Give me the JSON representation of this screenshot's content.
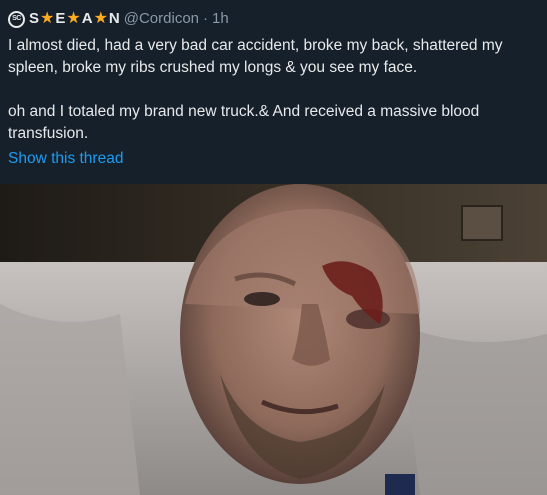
{
  "tweet": {
    "account_logo_text": "SC",
    "name_parts": [
      "S",
      "E",
      "A",
      "N"
    ],
    "handle": "@Cordicon",
    "separator": "·",
    "time": "1h",
    "paragraph_1": "I almost died, had a very bad car accident, broke my back, shattered my spleen, broke my ribs crushed my longs & you see my face.",
    "paragraph_2": "oh and I totaled my brand new truck.& And received a massive blood transfusion.",
    "show_thread": "Show this thread"
  },
  "colors": {
    "background": "#15202b",
    "text": "#e7e9ea",
    "muted": "#8b98a5",
    "link": "#1d9bf0",
    "star": "#ffad1f"
  },
  "icons": {
    "logo": "sc-logo-icon",
    "star": "star-icon"
  }
}
